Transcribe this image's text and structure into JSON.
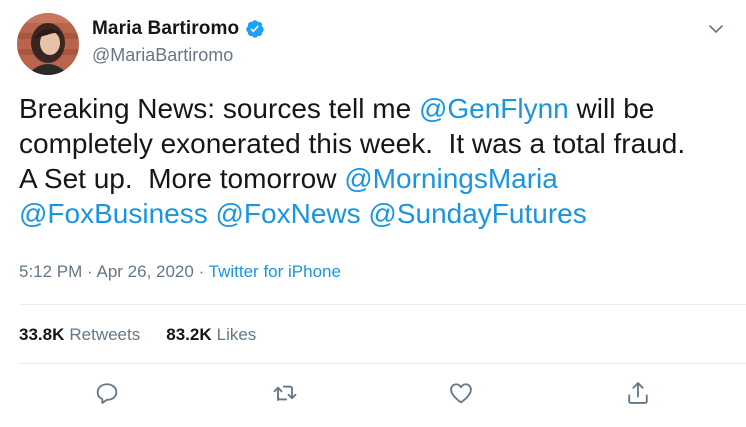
{
  "author": {
    "display_name": "Maria Bartiromo",
    "handle": "@MariaBartiromo",
    "verified": true
  },
  "tweet": {
    "parts": [
      {
        "type": "text",
        "value": "Breaking News: sources tell me "
      },
      {
        "type": "mention",
        "value": "@GenFlynn"
      },
      {
        "type": "text",
        "value": " will be\ncompletely exonerated this week.  It was a total fraud.\nA Set up.  More tomorrow "
      },
      {
        "type": "mention",
        "value": "@MorningsMaria"
      },
      {
        "type": "text",
        "value": "\n"
      },
      {
        "type": "mention",
        "value": "@FoxBusiness"
      },
      {
        "type": "text",
        "value": " "
      },
      {
        "type": "mention",
        "value": "@FoxNews"
      },
      {
        "type": "text",
        "value": " "
      },
      {
        "type": "mention",
        "value": "@SundayFutures"
      }
    ]
  },
  "meta": {
    "time": "5:12 PM",
    "sep1": " · ",
    "date": "Apr 26, 2020",
    "sep2": " · ",
    "source": "Twitter for iPhone"
  },
  "stats": {
    "retweets_count": "33.8K",
    "retweets_label": "Retweets",
    "likes_count": "83.2K",
    "likes_label": "Likes"
  },
  "icons": {
    "reply": "reply-icon",
    "retweet": "retweet-icon",
    "like": "like-icon",
    "share": "share-icon",
    "caret": "chevron-down-icon",
    "verified": "verified-badge-icon"
  },
  "colors": {
    "accent": "#1b95e0",
    "verified": "#1da1f2",
    "secondary_text": "#657786",
    "primary_text": "#14171a"
  }
}
